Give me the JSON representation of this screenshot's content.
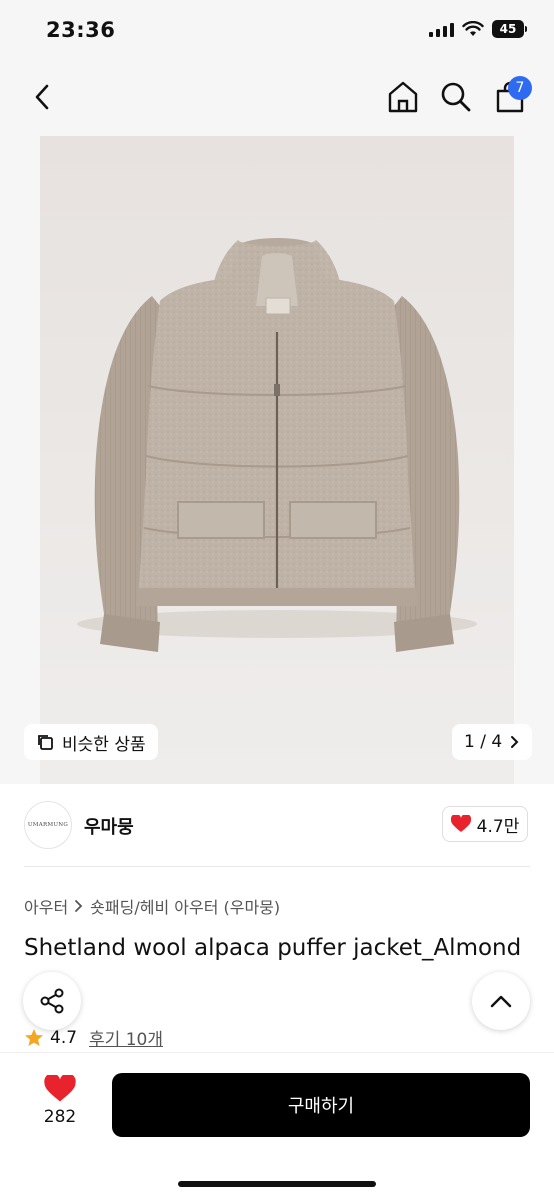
{
  "status_bar": {
    "time": "23:36",
    "battery": "45"
  },
  "header": {
    "back_icon": "chevron-left-icon",
    "home_icon": "home-icon",
    "search_icon": "search-icon",
    "bag_icon": "shopping-bag-icon",
    "bag_badge": "7",
    "badge_color": "#2f6bf1"
  },
  "gallery": {
    "similar_label": "비슷한 상품",
    "pager": "1 / 4"
  },
  "brand": {
    "logo_text": "UMARMUNG",
    "name": "우마뭉",
    "like_count": "4.7만",
    "heart_color": "#e8232e"
  },
  "product": {
    "category": [
      "아우터",
      "숏패딩/헤비 아우터 (우마뭉)"
    ],
    "title": "Shetland wool alpaca puffer jacket_Almond",
    "rating": "4.7",
    "reviews": "후기 10개",
    "star_color": "#f5a623"
  },
  "bottom": {
    "wish_count": "282",
    "buy_label": "구매하기"
  }
}
